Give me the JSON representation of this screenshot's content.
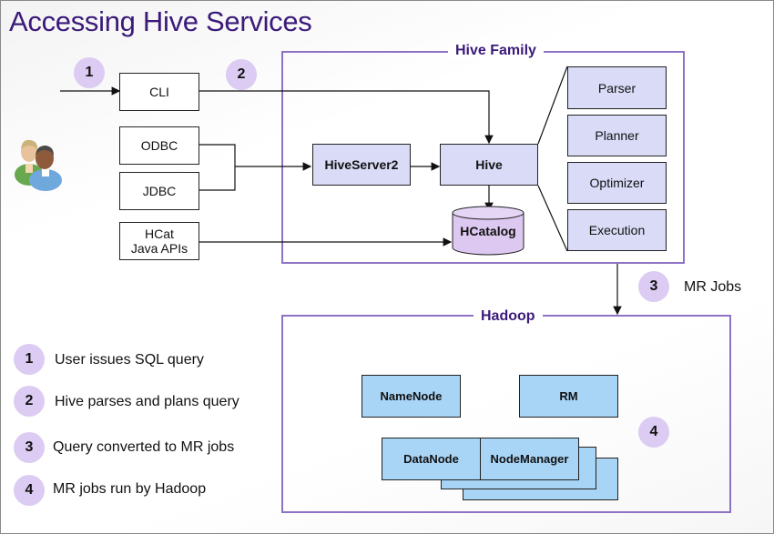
{
  "title": "Accessing Hive Services",
  "groups": {
    "hive_family": "Hive Family",
    "hadoop": "Hadoop"
  },
  "clients": {
    "cli": "CLI",
    "odbc": "ODBC",
    "jdbc": "JDBC",
    "hcat_line1": "HCat",
    "hcat_line2": "Java APIs"
  },
  "hive_components": {
    "hiveserver2": "HiveServer2",
    "hive": "Hive",
    "hcatalog": "HCatalog",
    "parser": "Parser",
    "planner": "Planner",
    "optimizer": "Optimizer",
    "execution": "Execution"
  },
  "hadoop_components": {
    "namenode": "NameNode",
    "rm": "RM",
    "datanode": "DataNode",
    "nodemanager": "NodeManager"
  },
  "step_badges": [
    "1",
    "2",
    "3",
    "4"
  ],
  "mr_jobs_label": "MR Jobs",
  "legend": [
    {
      "num": "1",
      "text": "User issues SQL query"
    },
    {
      "num": "2",
      "text": "Hive parses and plans query"
    },
    {
      "num": "3",
      "text": "Query converted to MR jobs"
    },
    {
      "num": "4",
      "text": "MR jobs run by Hadoop"
    }
  ],
  "colors": {
    "title": "#3b1a7a",
    "group_border": "#8e72c4",
    "hive_box": "#d9dbf7",
    "hadoop_box": "#a8d4f5",
    "badge": "#dccbf2"
  }
}
